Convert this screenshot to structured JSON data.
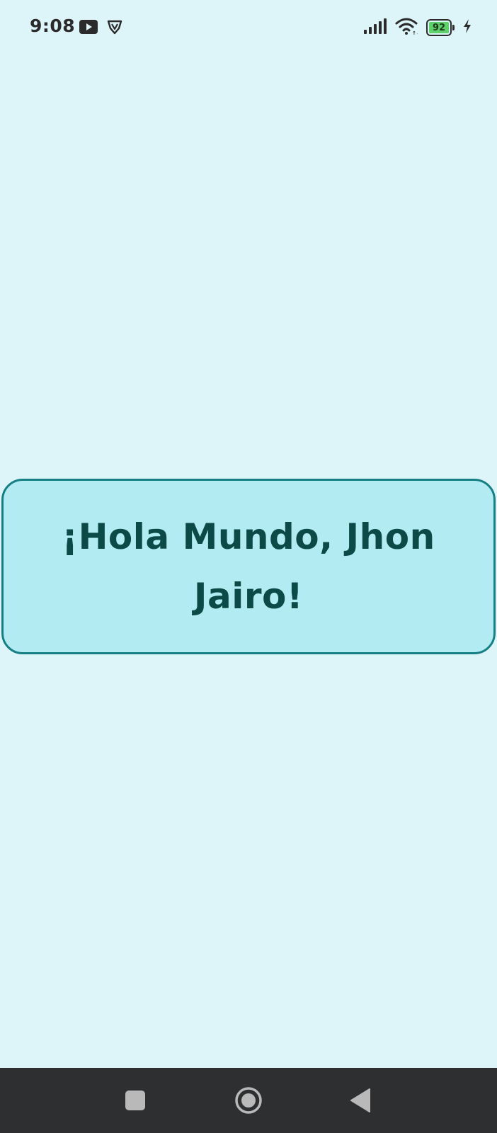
{
  "status_bar": {
    "time": "9:08",
    "left_icons": [
      "youtube-icon",
      "vpn-shield-icon"
    ],
    "right_icons": [
      "signal-icon",
      "wifi-icon",
      "battery-icon",
      "charging-bolt-icon"
    ],
    "battery_level": "92",
    "battery_fraction": 0.92
  },
  "main": {
    "greeting": "¡Hola Mundo, Jhon Jairo!"
  },
  "nav_bar": {
    "buttons": [
      "recents-square-icon",
      "home-circle-icon",
      "back-triangle-icon"
    ]
  },
  "colors": {
    "background": "#ddf5f8",
    "card_fill": "#b3ebf2",
    "card_border": "#167f86",
    "greeting_text": "#0c4a47",
    "nav_bar": "#2d2f31",
    "battery_fill": "#5ed16a"
  }
}
